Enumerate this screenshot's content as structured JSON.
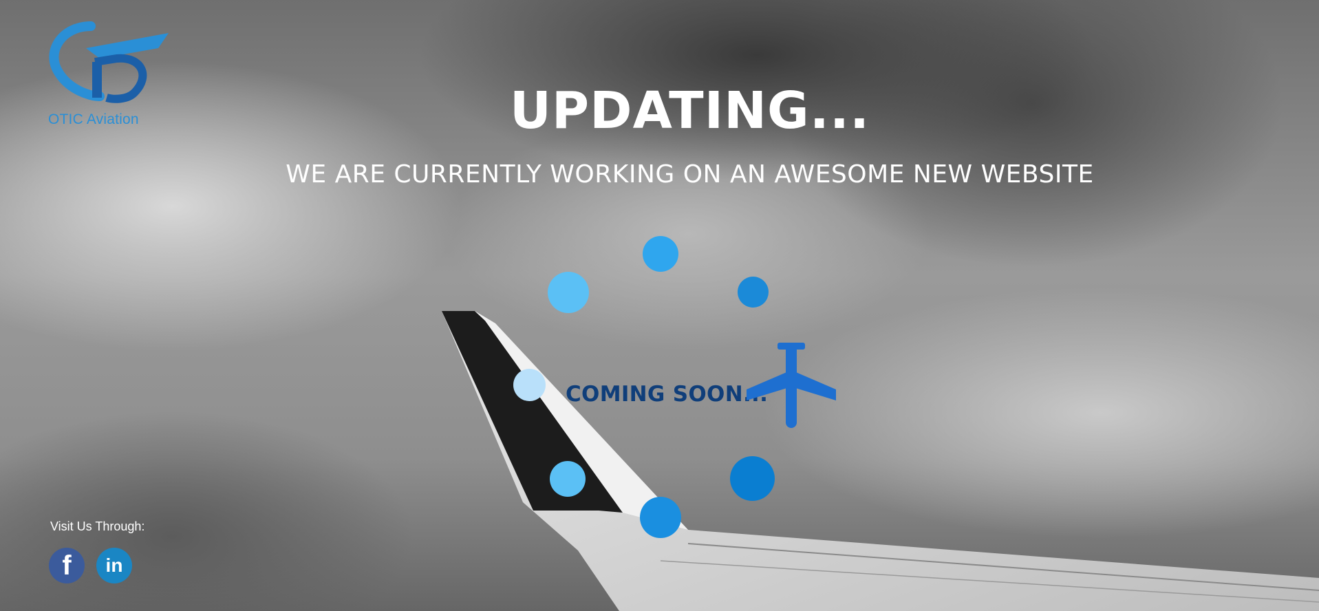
{
  "brand": {
    "name": "OTIC Aviation",
    "logo_icon": "otic-aviation-logo-icon",
    "color": "#2a8fd6"
  },
  "hero": {
    "headline": "UPDATING...",
    "subline": "WE ARE CURRENTLY WORKING ON AN AWESOME NEW WEBSITE"
  },
  "loader": {
    "label": "COMING SOON...",
    "label_color": "#0f3e7a",
    "icon": "airplane-icon",
    "dot_colors": [
      "#2fa6ee",
      "#1b8ad8",
      "#0a7ed1",
      "#1a8fe0",
      "#5bc0f5",
      "#b9e0fa",
      "#5bc0f5"
    ]
  },
  "footer": {
    "visit_label": "Visit Us Through:",
    "social": [
      {
        "name": "facebook",
        "glyph": "f",
        "icon": "facebook-icon",
        "color": "#3b5b9c"
      },
      {
        "name": "linkedin",
        "glyph": "in",
        "icon": "linkedin-icon",
        "color": "#1a86c4"
      }
    ]
  }
}
